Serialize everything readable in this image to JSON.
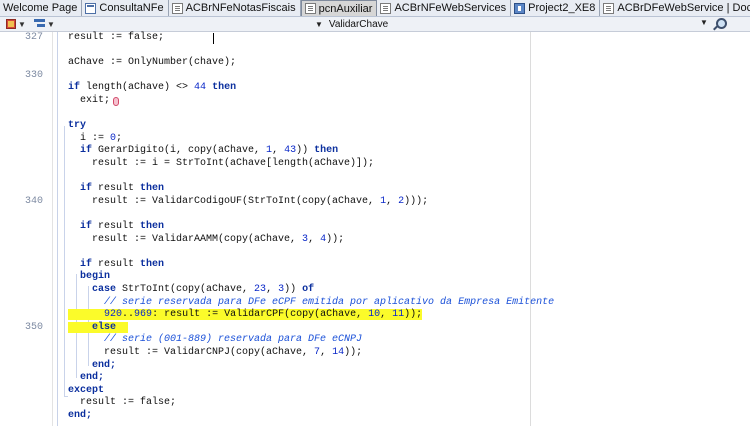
{
  "tabs": [
    {
      "label": "Welcome Page",
      "icon": "none",
      "active": false
    },
    {
      "label": "ConsultaNFe",
      "icon": "form-icon",
      "active": false
    },
    {
      "label": "ACBrNFeNotasFiscais",
      "icon": "unit-icon",
      "active": false
    },
    {
      "label": "pcnAuxiliar",
      "icon": "unit-icon",
      "active": true
    },
    {
      "label": "ACBrNFeWebServices",
      "icon": "unit-icon",
      "active": false
    },
    {
      "label": "Project2_XE8",
      "icon": "project-icon",
      "active": false
    },
    {
      "label": "ACBrDFeWebService | Documentation",
      "icon": "unit-icon",
      "active": false
    }
  ],
  "toolbar": {
    "method_select_value": "ValidarChave"
  },
  "gutter": {
    "line_numbers": [
      "327",
      "330",
      "340",
      "350"
    ]
  },
  "code": {
    "l01": "result := false;",
    "l02": "aChave := OnlyNumber(chave);",
    "l03a": "if",
    "l03b": " length(aChave) <> ",
    "l03c": "44",
    "l03d": " then",
    "l04": "  exit;",
    "l05": "try",
    "l06a": "  i := ",
    "l06b": "0",
    "l06c": ";",
    "l07a": "  if",
    "l07b": " GerarDigito(i, copy(aChave, ",
    "l07c": "1",
    "l07d": ", ",
    "l07e": "43",
    "l07f": ")) ",
    "l07g": "then",
    "l08": "    result := i = StrToInt(aChave[length(aChave)]);",
    "l09a": "  if",
    "l09b": " result ",
    "l09c": "then",
    "l10a": "    result := ValidarCodigoUF(StrToInt(copy(aChave, ",
    "l10b": "1",
    "l10c": ", ",
    "l10d": "2",
    "l10e": ")));",
    "l11a": "  if",
    "l11b": " result ",
    "l11c": "then",
    "l12a": "    result := ValidarAAMM(copy(aChave, ",
    "l12b": "3",
    "l12c": ", ",
    "l12d": "4",
    "l12e": "));",
    "l13a": "  if",
    "l13b": " result ",
    "l13c": "then",
    "l14": "  begin",
    "l15a": "    case",
    "l15b": " StrToInt(copy(aChave, ",
    "l15c": "23",
    "l15d": ", ",
    "l15e": "3",
    "l15f": ")) ",
    "l15g": "of",
    "l16": "      // serie reservada para DFe eCPF emitida por aplicativo da Empresa Emitente",
    "l17a": "920",
    "l17b": "..",
    "l17c": "969",
    "l17d": ": result := ValidarCPF(copy(aChave, ",
    "l17e": "10",
    "l17f": ", ",
    "l17g": "11",
    "l17h": "));",
    "l18": "else",
    "l19": "      // serie (001-889) reservada para DFe eCNPJ",
    "l20a": "      result := ValidarCNPJ(copy(aChave, ",
    "l20b": "7",
    "l20c": ", ",
    "l20d": "14",
    "l20e": "));",
    "l21": "    end;",
    "l22": "  end;",
    "l23": "except",
    "l24": "  result := false;",
    "l25": "end;"
  }
}
